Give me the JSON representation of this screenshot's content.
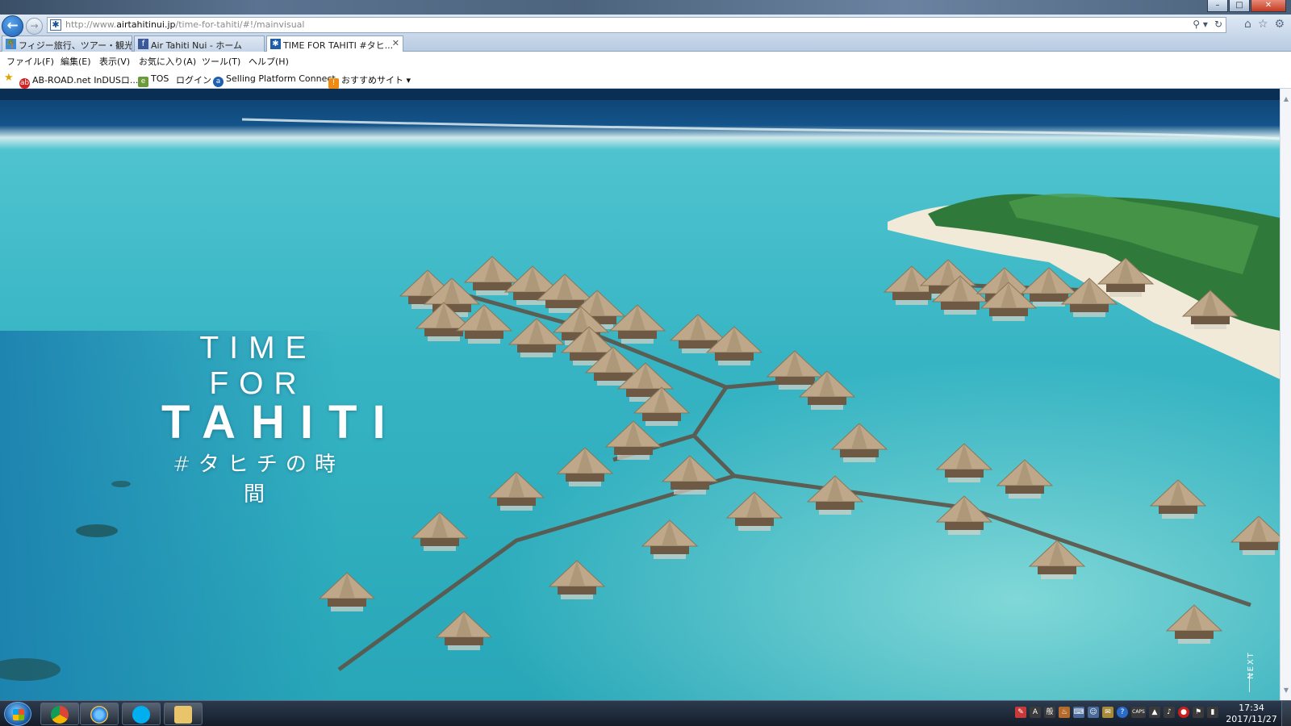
{
  "window": {
    "controls": {
      "minimize": "–",
      "maximize": "□",
      "close": "✕"
    }
  },
  "navigation": {
    "back_icon": "back-arrow-icon",
    "forward_icon": "forward-arrow-icon",
    "back_glyph": "←",
    "forward_glyph": "→"
  },
  "address_bar": {
    "prefix": "http://www.",
    "domain": "airtahitinui.jp",
    "path": "/time-for-tahiti/#!/mainvisual",
    "favicon": "✱",
    "tools": {
      "search": "⚲ ▾",
      "refresh": "↻"
    }
  },
  "tabs": [
    {
      "label": "フィジー旅行、ツアー・観光...",
      "icon": "🌴",
      "icon_color": "#3b8bd8",
      "active": false
    },
    {
      "label": "Air Tahiti Nui - ホーム",
      "icon": "f",
      "icon_color": "#3b5998",
      "active": false
    },
    {
      "label": "TIME FOR TAHITI #タヒ...",
      "icon": "✱",
      "icon_color": "#1e5ea8",
      "active": true,
      "close": "✕"
    }
  ],
  "browser_icons": {
    "home": "⌂",
    "favorites": "☆",
    "settings": "⚙"
  },
  "menu": [
    {
      "label": "ファイル(F)"
    },
    {
      "label": "編集(E)"
    },
    {
      "label": "表示(V)"
    },
    {
      "label": "お気に入り(A)"
    },
    {
      "label": "ツール(T)"
    },
    {
      "label": "ヘルプ(H)"
    }
  ],
  "favorites_bar": {
    "star_icon": "★",
    "items": [
      {
        "label": "AB-ROAD.net InDUSロ...",
        "icon": "ab",
        "icon_color": "#d32020"
      },
      {
        "label": "TOS",
        "icon": "e",
        "icon_color": "#6a9a3a"
      },
      {
        "label": "ログイン",
        "icon": "",
        "icon_color": "#ffffff"
      },
      {
        "label": "Selling Platform Connect",
        "icon": "a",
        "icon_color": "#1d5fb0"
      },
      {
        "label": "おすすめサイト ▾",
        "icon": "!",
        "icon_color": "#f08a10"
      }
    ]
  },
  "hero": {
    "line1": "TIME FOR",
    "line2": "TAHITI",
    "line3": "#タヒチの時間",
    "next_label": "NEXT"
  },
  "taskbar": {
    "apps": [
      {
        "name": "chrome",
        "icon": "chrome-icon"
      },
      {
        "name": "internet-explorer",
        "icon": "ie-icon"
      },
      {
        "name": "skype",
        "icon": "skype-icon"
      },
      {
        "name": "file-explorer",
        "icon": "folder-icon"
      }
    ],
    "tray_icons": [
      {
        "glyph": "✎",
        "color": "#c83a3a"
      },
      {
        "glyph": "A",
        "color": "#3a3a3a"
      },
      {
        "glyph": "般",
        "color": "#3a3a3a"
      },
      {
        "glyph": "♨",
        "color": "#b46a2a"
      },
      {
        "glyph": "⌨",
        "color": "#4a6a9a"
      },
      {
        "glyph": "☺",
        "color": "#4a6a9a"
      },
      {
        "glyph": "✉",
        "color": "#a88a3a"
      },
      {
        "glyph": "?",
        "color": "#2a6ac8"
      },
      {
        "glyph": "CAPS",
        "color": "#3a3a3a"
      },
      {
        "glyph": "▲",
        "color": "#3a3a3a"
      },
      {
        "glyph": "♪",
        "color": "#3a3a3a"
      },
      {
        "glyph": "●",
        "color": "#c82020"
      },
      {
        "glyph": "⚑",
        "color": "#3a3a3a"
      },
      {
        "glyph": "▮",
        "color": "#3a3a3a"
      }
    ],
    "clock": {
      "time": "17:34",
      "date": "2017/11/27"
    }
  }
}
